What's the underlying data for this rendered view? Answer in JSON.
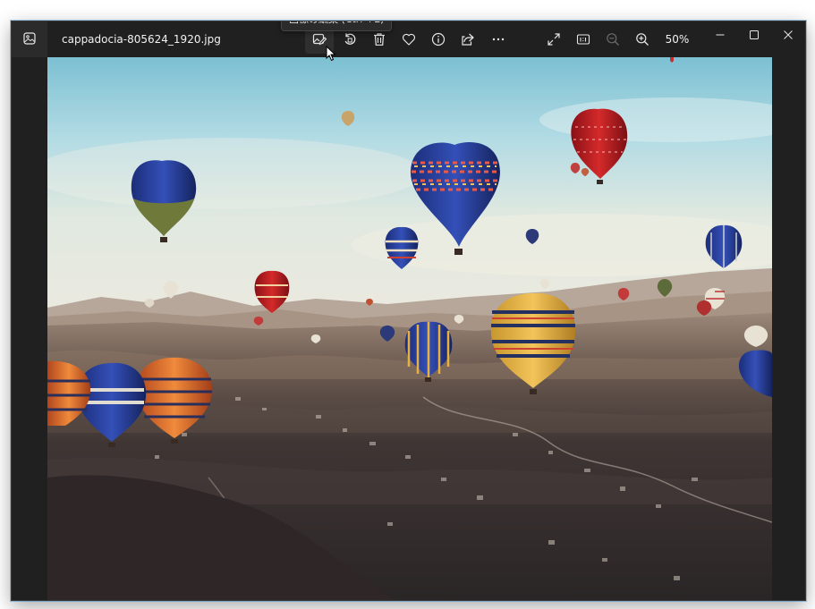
{
  "window": {
    "filename": "cappadocia-805624_1920.jpg",
    "zoom_level": "50%"
  },
  "tooltip": {
    "text": "画像の編集 (Ctrl +E)"
  },
  "toolbar": {
    "buttons": [
      {
        "name": "edit-image",
        "icon": "edit-image-icon",
        "active": true
      },
      {
        "name": "rotate",
        "icon": "rotate-icon"
      },
      {
        "name": "delete",
        "icon": "trash-icon"
      },
      {
        "name": "favorite",
        "icon": "heart-icon"
      },
      {
        "name": "file-info",
        "icon": "info-icon"
      },
      {
        "name": "share",
        "icon": "share-icon"
      },
      {
        "name": "more",
        "icon": "more-icon"
      }
    ],
    "view_buttons": [
      {
        "name": "fit-to-window",
        "icon": "expand-icon"
      },
      {
        "name": "actual-size",
        "icon": "actual-size-icon"
      },
      {
        "name": "zoom-out",
        "icon": "zoom-out-icon",
        "disabled": true
      },
      {
        "name": "zoom-in",
        "icon": "zoom-in-icon"
      }
    ]
  },
  "photo": {
    "subject": "hot-air-balloons"
  },
  "colors": {
    "window_bg": "#202020",
    "text": "#f2f2f2",
    "icon": "#e6e6e6",
    "icon_disabled": "#6a6a6a",
    "tooltip_bg": "#2b2b2b"
  }
}
